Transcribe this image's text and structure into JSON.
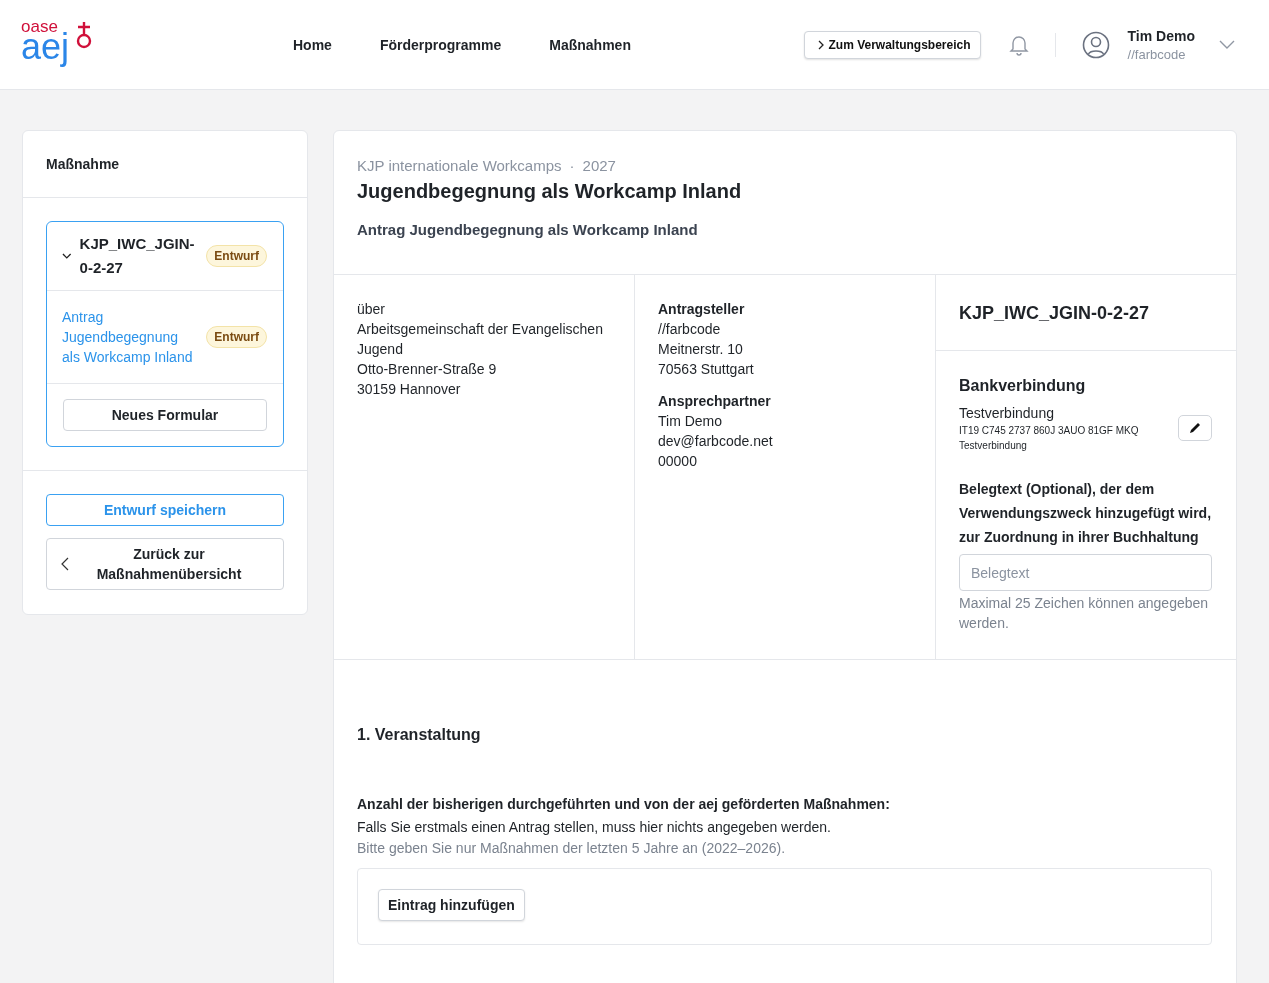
{
  "header": {
    "logo": {
      "top": "oase",
      "main": "aej"
    },
    "nav": [
      {
        "label": "Home"
      },
      {
        "label": "Förderprogramme"
      },
      {
        "label": "Maßnahmen"
      }
    ],
    "admin_button": {
      "label": "Zum Verwaltungsbereich"
    },
    "user": {
      "name": "Tim Demo",
      "org": "//farbcode"
    }
  },
  "sidebar": {
    "title": "Maßnahme",
    "measure": {
      "code": "KJP_IWC_JGIN-0-2-27",
      "status": "Entwurf",
      "expanded": true,
      "forms": [
        {
          "label": "Antrag Jugendbegegnung als Workcamp Inland",
          "status": "Entwurf"
        }
      ],
      "new_form_button": "Neues Formular"
    },
    "save_button": "Entwurf speichern",
    "back_button": "Zurück zur Maßnahmenübersicht"
  },
  "main": {
    "program": "KJP internationale Workcamps",
    "separator": "·",
    "year": "2027",
    "title": "Jugendbegegnung als Workcamp Inland",
    "subtitle": "Antrag Jugendbegegnung als Workcamp Inland",
    "via": {
      "lines": [
        "über",
        "Arbeitsgemeinschaft der Evangelischen Jugend",
        "Otto-Brenner-Straße 9",
        "30159 Hannover"
      ]
    },
    "applicant": {
      "heading": "Antragsteller",
      "lines": [
        "//farbcode",
        "Meitnerstr. 10",
        "70563 Stuttgart"
      ]
    },
    "contact": {
      "heading": "Ansprechpartner",
      "lines": [
        "Tim Demo",
        "dev@farbcode.net",
        "00000"
      ]
    },
    "code": "KJP_IWC_JGIN-0-2-27",
    "bank": {
      "heading": "Bankverbindung",
      "name": "Testverbindung",
      "iban": "IT19 C745 2737 860J 3AUO 81GF MKQ",
      "holder": "Testverbindung"
    },
    "receipt": {
      "label": "Belegtext (Optional), der dem Verwendungszweck hinzugefügt wird, zur Zuordnung in ihrer Buchhaltung",
      "placeholder": "Belegtext",
      "hint": "Maximal 25 Zeichen können angegeben werden."
    },
    "section": {
      "title": "1. Veranstaltung",
      "question": "Anzahl der bisherigen durchgeführten und von der aej geförderten Maßnahmen:",
      "note": "Falls Sie erstmals einen Antrag stellen, muss hier nichts angegeben werden.",
      "hint": "Bitte geben Sie nur Maßnahmen der letzten 5 Jahre an (2022–2026).",
      "add_button": "Eintrag hinzufügen"
    }
  }
}
